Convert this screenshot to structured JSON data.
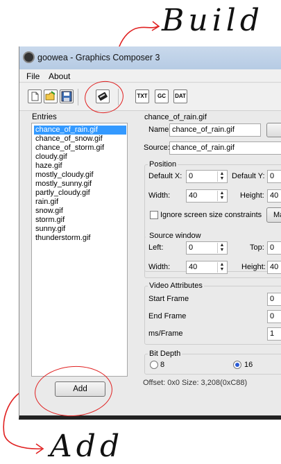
{
  "annotations": {
    "build": "Build",
    "add": "Add"
  },
  "window": {
    "title": "goowea - Graphics Composer 3"
  },
  "menu": [
    "File",
    "About"
  ],
  "toolbar": {
    "icons": [
      "new-file-icon",
      "open-folder-icon",
      "save-icon",
      "build-icon"
    ],
    "export_labels": [
      "TXT",
      "GC",
      "DAT"
    ]
  },
  "entries": {
    "label": "Entries",
    "items": [
      "chance_of_rain.gif",
      "chance_of_snow.gif",
      "chance_of_storm.gif",
      "cloudy.gif",
      "haze.gif",
      "mostly_cloudy.gif",
      "mostly_sunny.gif",
      "partly_cloudy.gif",
      "rain.gif",
      "snow.gif",
      "storm.gif",
      "sunny.gif",
      "thunderstorm.gif"
    ],
    "selected": "chance_of_rain.gif",
    "add_label": "Add"
  },
  "detail": {
    "heading": "chance_of_rain.gif",
    "name_label": "Name:",
    "name_value": "chance_of_rain.gif",
    "source_label": "Source:",
    "source_value": "chance_of_rain.gif",
    "position": {
      "title": "Position",
      "default_x_label": "Default X:",
      "default_x": "0",
      "default_y_label": "Default Y:",
      "default_y": "0",
      "width_label": "Width:",
      "width": "40",
      "height_label": "Height:",
      "height": "40",
      "ignore_label": "Ignore screen size constraints",
      "ma_button": "Ma"
    },
    "source_window": {
      "title": "Source window",
      "left_label": "Left:",
      "left": "0",
      "top_label": "Top:",
      "top": "0",
      "width_label": "Width:",
      "width": "40",
      "height_label": "Height:",
      "height": "40"
    },
    "video": {
      "title": "Video Attributes",
      "start_label": "Start Frame",
      "start": "0",
      "end_label": "End Frame",
      "end": "0",
      "ms_label": "ms/Frame",
      "ms": "1"
    },
    "bit_depth": {
      "title": "Bit Depth",
      "opt8": "8",
      "opt16": "16",
      "selected": "16"
    },
    "info": "Offset: 0x0  Size: 3,208(0xC88)"
  },
  "colors": {
    "selection": "#3399ff",
    "annotation_red": "#e02020"
  }
}
